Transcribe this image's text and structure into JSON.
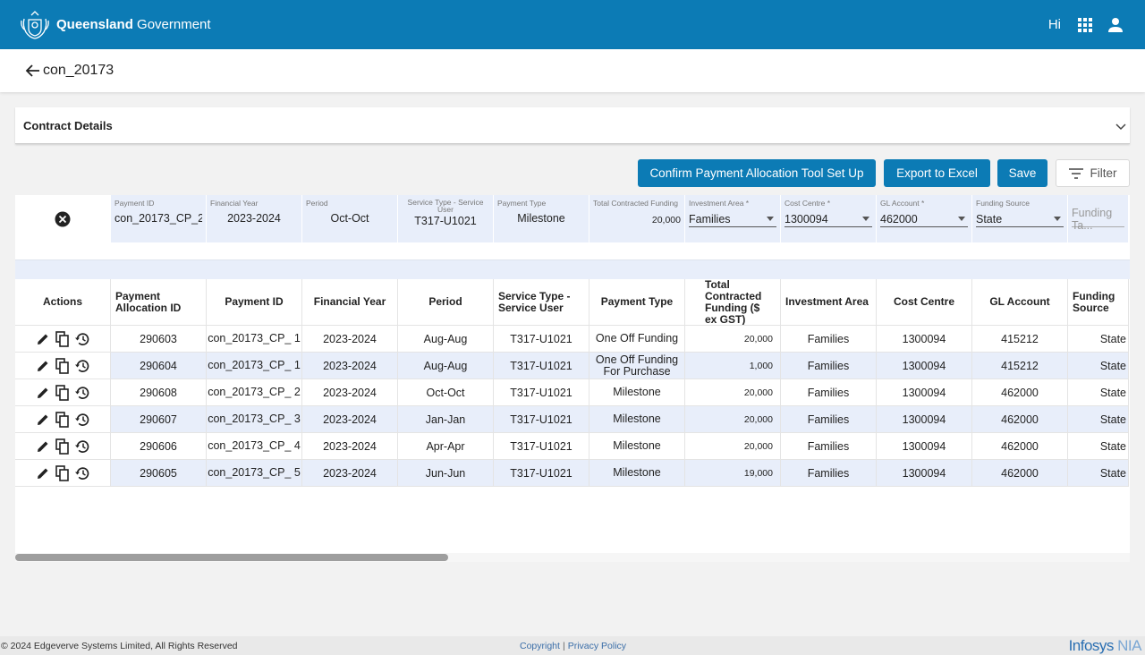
{
  "header": {
    "brand_bold": "Queensland",
    "brand_rest": " Government",
    "greeting": "Hi"
  },
  "page": {
    "title": "con_20173"
  },
  "contract": {
    "title": "Contract Details"
  },
  "toolbar": {
    "confirm_label": "Confirm Payment Allocation Tool Set Up",
    "export_label": "Export to Excel",
    "save_label": "Save",
    "filter_label": "Filter"
  },
  "edit_row": {
    "payment_id_label": "Payment ID",
    "payment_id": "con_20173_CP_2",
    "financial_year_label": "Financial Year",
    "financial_year": "2023-2024",
    "period_label": "Period",
    "period": "Oct-Oct",
    "service_type_label": "Service Type - Service User",
    "service_type": "T317-U1021",
    "payment_type_label": "Payment Type",
    "payment_type": "Milestone",
    "total_funding_label": "Total Contracted Funding",
    "total_funding": "20,000",
    "investment_area_label": "Investment Area *",
    "investment_area": "Families",
    "cost_centre_label": "Cost Centre *",
    "cost_centre": "1300094",
    "gl_account_label": "GL Account *",
    "gl_account": "462000",
    "funding_source_label": "Funding Source",
    "funding_source": "State",
    "funding_tag_placeholder": "Funding Ta..."
  },
  "table": {
    "headers": {
      "actions": "Actions",
      "allocation_id": "Payment Allocation ID",
      "payment_id": "Payment ID",
      "financial_year": "Financial Year",
      "period": "Period",
      "service_type": "Service Type - Service User",
      "payment_type": "Payment Type",
      "total_funding": "Total Contracted Funding ($ ex GST)",
      "investment_area": "Investment Area",
      "cost_centre": "Cost Centre",
      "gl_account": "GL Account",
      "funding_source": "Funding Source"
    },
    "rows": [
      {
        "allocation_id": "290603",
        "payment_id": "con_20173_CP_ 1",
        "financial_year": "2023-2024",
        "period": "Aug-Aug",
        "service_type": "T317-U1021",
        "payment_type": "One Off Funding",
        "total_funding": "20,000",
        "investment_area": "Families",
        "cost_centre": "1300094",
        "gl_account": "415212",
        "funding_source": "State"
      },
      {
        "allocation_id": "290604",
        "payment_id": "con_20173_CP_ 1",
        "financial_year": "2023-2024",
        "period": "Aug-Aug",
        "service_type": "T317-U1021",
        "payment_type": "One Off Funding For Purchase",
        "total_funding": "1,000",
        "investment_area": "Families",
        "cost_centre": "1300094",
        "gl_account": "415212",
        "funding_source": "State"
      },
      {
        "allocation_id": "290608",
        "payment_id": "con_20173_CP_ 2",
        "financial_year": "2023-2024",
        "period": "Oct-Oct",
        "service_type": "T317-U1021",
        "payment_type": "Milestone",
        "total_funding": "20,000",
        "investment_area": "Families",
        "cost_centre": "1300094",
        "gl_account": "462000",
        "funding_source": "State"
      },
      {
        "allocation_id": "290607",
        "payment_id": "con_20173_CP_ 3",
        "financial_year": "2023-2024",
        "period": "Jan-Jan",
        "service_type": "T317-U1021",
        "payment_type": "Milestone",
        "total_funding": "20,000",
        "investment_area": "Families",
        "cost_centre": "1300094",
        "gl_account": "462000",
        "funding_source": "State"
      },
      {
        "allocation_id": "290606",
        "payment_id": "con_20173_CP_ 4",
        "financial_year": "2023-2024",
        "period": "Apr-Apr",
        "service_type": "T317-U1021",
        "payment_type": "Milestone",
        "total_funding": "20,000",
        "investment_area": "Families",
        "cost_centre": "1300094",
        "gl_account": "462000",
        "funding_source": "State"
      },
      {
        "allocation_id": "290605",
        "payment_id": "con_20173_CP_ 5",
        "financial_year": "2023-2024",
        "period": "Jun-Jun",
        "service_type": "T317-U1021",
        "payment_type": "Milestone",
        "total_funding": "19,000",
        "investment_area": "Families",
        "cost_centre": "1300094",
        "gl_account": "462000",
        "funding_source": "State"
      }
    ]
  },
  "footer": {
    "copyright": "© 2024 Edgeverve Systems Limited, All Rights Reserved",
    "copyright_link": "Copyright",
    "separator": "|",
    "privacy_link": "Privacy Policy",
    "logo_main": "Infosys",
    "logo_suffix": "NIA"
  },
  "colors": {
    "header_blue": "#0c7bb5",
    "row_highlight": "#e8eefa"
  },
  "icons": [
    "qld-crest-icon",
    "apps-grid-icon",
    "user-icon",
    "arrow-back-icon",
    "chevron-down-icon",
    "close-circle-icon",
    "filter-icon",
    "edit-pencil-icon",
    "copy-icon",
    "history-icon"
  ]
}
